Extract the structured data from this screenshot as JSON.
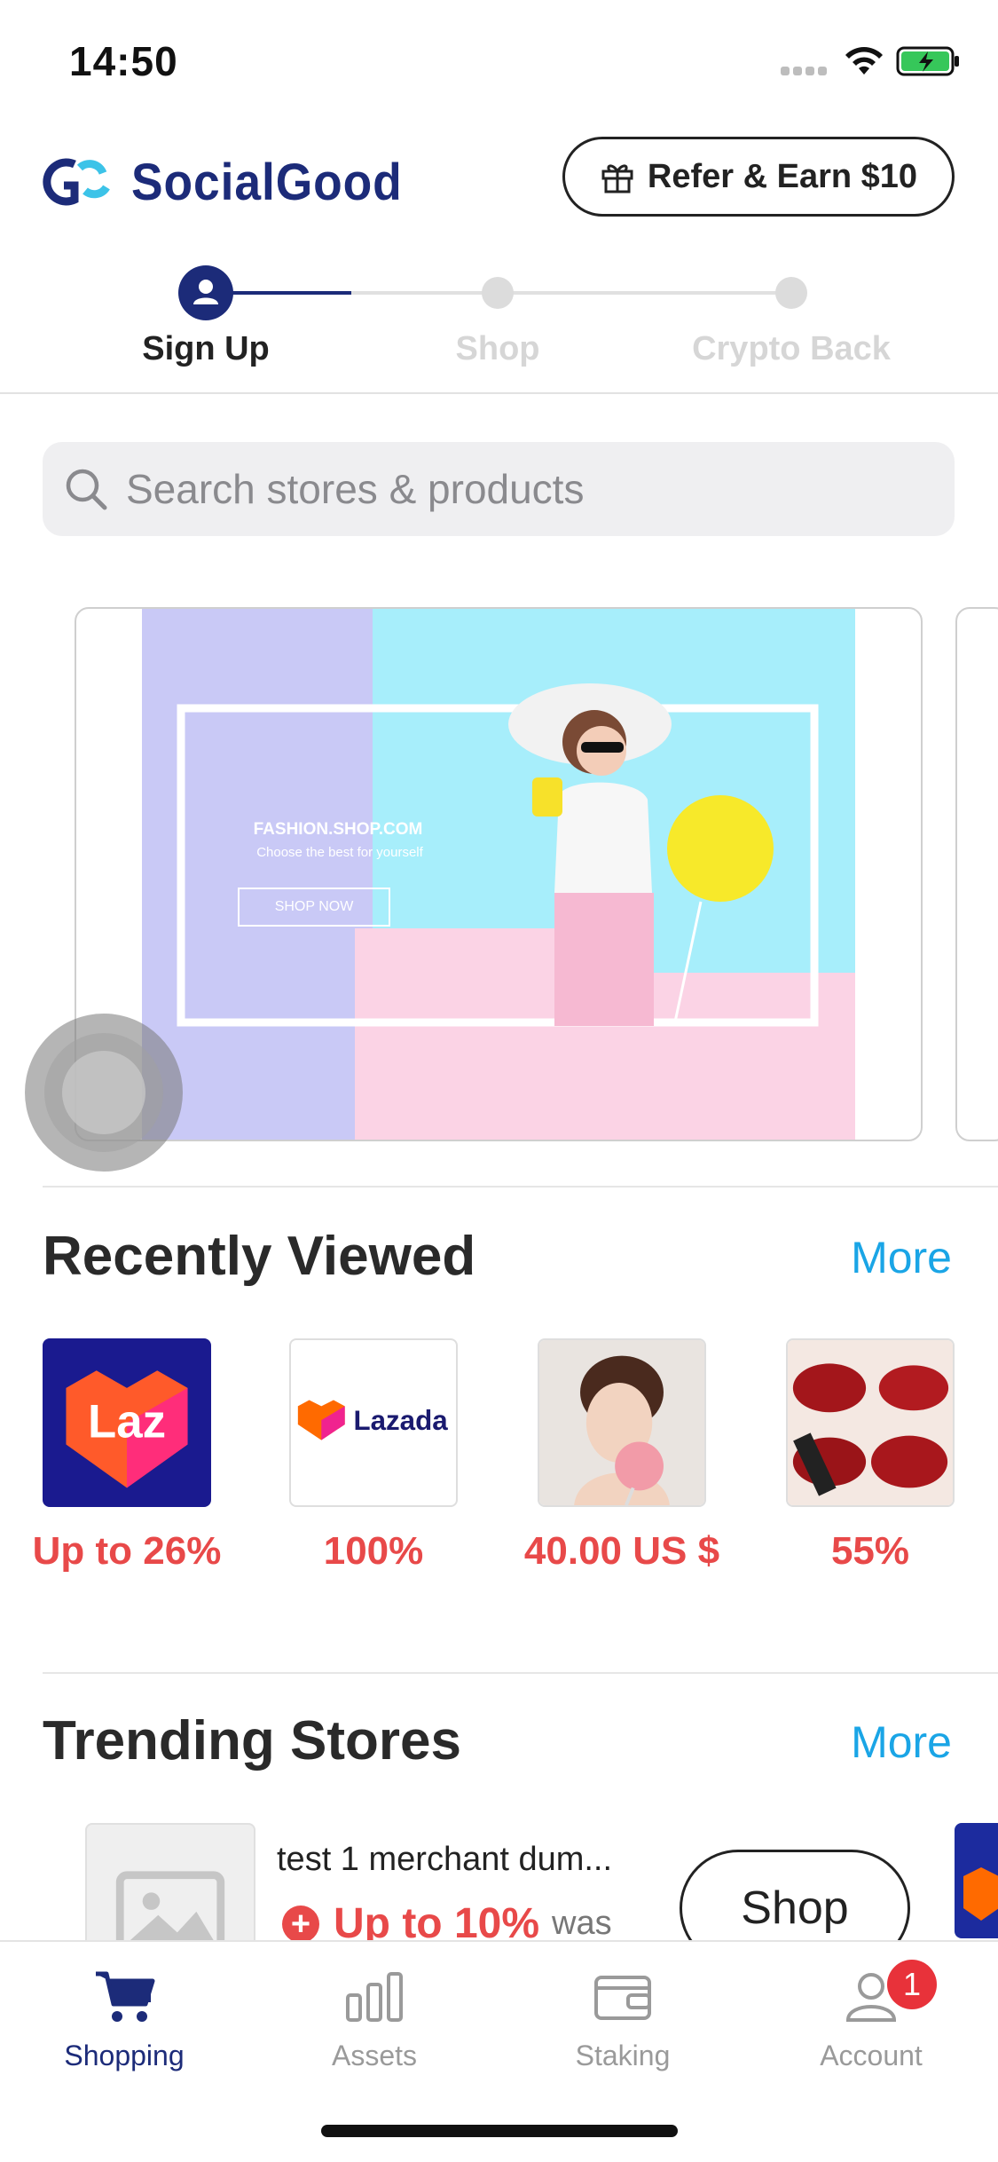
{
  "status_bar": {
    "time": "14:50"
  },
  "header": {
    "brand_name": "SocialGood",
    "refer_label": "Refer & Earn $10"
  },
  "stepper": {
    "steps": [
      {
        "label": "Sign Up",
        "active": true
      },
      {
        "label": "Shop",
        "active": false
      },
      {
        "label": "Crypto Back",
        "active": false
      }
    ]
  },
  "search": {
    "placeholder": "Search stores & products"
  },
  "banner": {
    "title": "FASHION.SHOP.COM",
    "subtitle": "Choose the best for yourself",
    "cta": "SHOP NOW"
  },
  "recently_viewed": {
    "title": "Recently Viewed",
    "more": "More",
    "items": [
      {
        "thumb": "lazada-app-logo",
        "label": "Up to 26%"
      },
      {
        "thumb": "lazada-wordmark-logo",
        "label": "100%"
      },
      {
        "thumb": "product-photo-lollipop",
        "label": "40.00 US $"
      },
      {
        "thumb": "product-photo-lipstick",
        "label": "55%"
      }
    ]
  },
  "trending": {
    "title": "Trending Stores",
    "more": "More",
    "stores": [
      {
        "name": "test 1 merchant dum...",
        "cashback": "Up to 10%",
        "was": "was",
        "shop_label": "Shop"
      }
    ]
  },
  "tabbar": {
    "tabs": [
      {
        "label": "Shopping",
        "icon": "cart-icon",
        "active": true
      },
      {
        "label": "Assets",
        "icon": "bar-chart-icon",
        "active": false
      },
      {
        "label": "Staking",
        "icon": "wallet-icon",
        "active": false
      },
      {
        "label": "Account",
        "icon": "user-icon",
        "active": false,
        "badge": "1"
      }
    ]
  },
  "colors": {
    "brand": "#1c2b79",
    "accent_link": "#1aa5e6",
    "cashback_red": "#e84949",
    "inactive": "#9a9a9a"
  }
}
